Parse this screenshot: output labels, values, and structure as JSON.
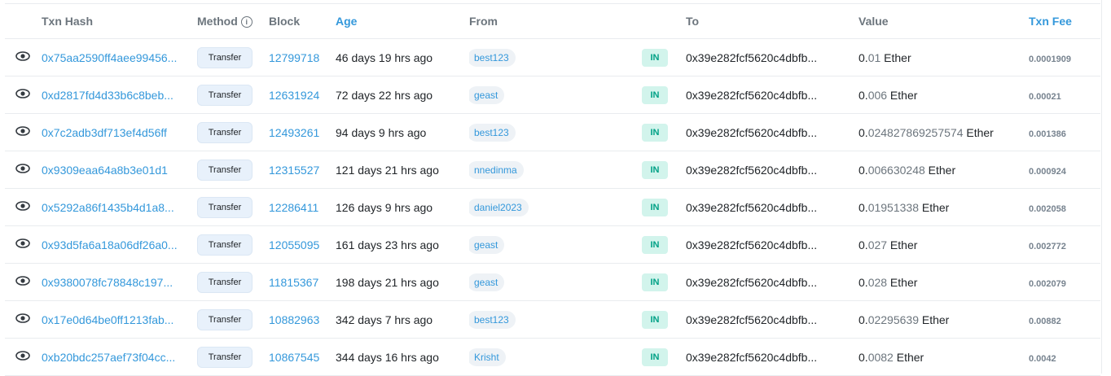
{
  "header": {
    "txn_hash": "Txn Hash",
    "method": "Method",
    "method_info_icon": "info-icon",
    "block": "Block",
    "age": "Age",
    "from": "From",
    "to": "To",
    "value": "Value",
    "txn_fee": "Txn Fee"
  },
  "colors": {
    "link": "#3498db",
    "in_badge_bg": "#d2f4ec",
    "in_badge_text": "#00a186"
  },
  "rows": [
    {
      "hash": "0x75aa2590ff4aee99456...",
      "method": "Transfer",
      "block": "12799718",
      "age": "46 days 19 hrs ago",
      "from": "best123",
      "direction": "IN",
      "to": "0x39e282fcf5620c4dbfb...",
      "value_int": "0.",
      "value_frac": "01",
      "value_unit": " Ether",
      "fee": "0.0001909"
    },
    {
      "hash": "0xd2817fd4d33b6c8beb...",
      "method": "Transfer",
      "block": "12631924",
      "age": "72 days 22 hrs ago",
      "from": "geast",
      "direction": "IN",
      "to": "0x39e282fcf5620c4dbfb...",
      "value_int": "0.",
      "value_frac": "006",
      "value_unit": " Ether",
      "fee": "0.00021"
    },
    {
      "hash": "0x7c2adb3df713ef4d56ff",
      "method": "Transfer",
      "block": "12493261",
      "age": "94 days 9 hrs ago",
      "from": "best123",
      "direction": "IN",
      "to": "0x39e282fcf5620c4dbfb...",
      "value_int": "0.",
      "value_frac": "024827869257574",
      "value_unit": " Ether",
      "fee": "0.001386"
    },
    {
      "hash": "0x9309eaa64a8b3e01d1",
      "method": "Transfer",
      "block": "12315527",
      "age": "121 days 21 hrs ago",
      "from": "nnedinma",
      "direction": "IN",
      "to": "0x39e282fcf5620c4dbfb...",
      "value_int": "0.",
      "value_frac": "006630248",
      "value_unit": " Ether",
      "fee": "0.000924"
    },
    {
      "hash": "0x5292a86f1435b4d1a8...",
      "method": "Transfer",
      "block": "12286411",
      "age": "126 days 9 hrs ago",
      "from": "daniel2023",
      "direction": "IN",
      "to": "0x39e282fcf5620c4dbfb...",
      "value_int": "0.",
      "value_frac": "01951338",
      "value_unit": " Ether",
      "fee": "0.002058"
    },
    {
      "hash": "0x93d5fa6a18a06df26a0...",
      "method": "Transfer",
      "block": "12055095",
      "age": "161 days 23 hrs ago",
      "from": "geast",
      "direction": "IN",
      "to": "0x39e282fcf5620c4dbfb...",
      "value_int": "0.",
      "value_frac": "027",
      "value_unit": " Ether",
      "fee": "0.002772"
    },
    {
      "hash": "0x9380078fc78848c197...",
      "method": "Transfer",
      "block": "11815367",
      "age": "198 days 21 hrs ago",
      "from": "geast",
      "direction": "IN",
      "to": "0x39e282fcf5620c4dbfb...",
      "value_int": "0.",
      "value_frac": "028",
      "value_unit": " Ether",
      "fee": "0.002079"
    },
    {
      "hash": "0x17e0d64be0ff1213fab...",
      "method": "Transfer",
      "block": "10882963",
      "age": "342 days 7 hrs ago",
      "from": "best123",
      "direction": "IN",
      "to": "0x39e282fcf5620c4dbfb...",
      "value_int": "0.",
      "value_frac": "02295639",
      "value_unit": " Ether",
      "fee": "0.00882"
    },
    {
      "hash": "0xb20bdc257aef73f04cc...",
      "method": "Transfer",
      "block": "10867545",
      "age": "344 days 16 hrs ago",
      "from": "Krisht",
      "direction": "IN",
      "to": "0x39e282fcf5620c4dbfb...",
      "value_int": "0.",
      "value_frac": "0082",
      "value_unit": " Ether",
      "fee": "0.0042"
    }
  ]
}
